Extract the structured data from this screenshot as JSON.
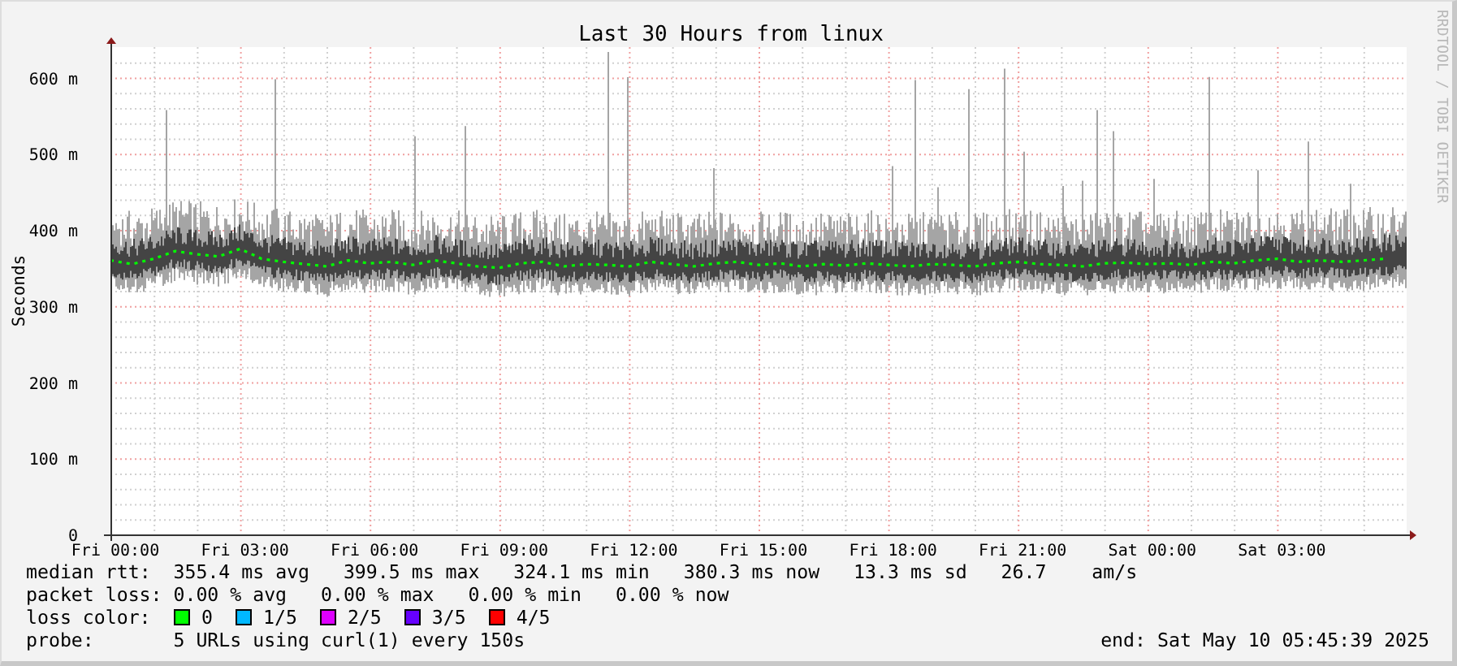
{
  "title": "Last 30 Hours from linux",
  "side_note": "RRDTOOL / TOBI OETIKER",
  "chart_data": {
    "type": "line",
    "grid": true,
    "ylabel": "Seconds",
    "ylim": [
      0,
      640
    ],
    "yticks": [
      {
        "value": 0,
        "label": "0"
      },
      {
        "value": 100,
        "label": "100 m"
      },
      {
        "value": 200,
        "label": "200 m"
      },
      {
        "value": 300,
        "label": "300 m"
      },
      {
        "value": 400,
        "label": "400 m"
      },
      {
        "value": 500,
        "label": "500 m"
      },
      {
        "value": 600,
        "label": "600 m"
      }
    ],
    "categories": [
      "Fri 00:00",
      null,
      null,
      null,
      null,
      null,
      "Fri 03:00",
      null,
      null,
      null,
      null,
      null,
      "Fri 06:00",
      null,
      null,
      null,
      null,
      null,
      "Fri 09:00",
      null,
      null,
      null,
      null,
      null,
      "Fri 12:00",
      null,
      null,
      null,
      null,
      null,
      "Fri 15:00",
      null,
      null,
      null,
      null,
      null,
      "Fri 18:00",
      null,
      null,
      null,
      null,
      null,
      "Fri 21:00",
      null,
      null,
      null,
      null,
      null,
      "Sat 00:00",
      null,
      null,
      null,
      null,
      null,
      "Sat 03:00",
      null,
      null,
      null,
      null,
      null
    ],
    "series": [
      {
        "name": "median rtt",
        "color": "#00ff00",
        "line_style": "dashed",
        "values": [
          360,
          355,
          362,
          372,
          368,
          365,
          375,
          362,
          358,
          355,
          352,
          360,
          356,
          358,
          354,
          360,
          356,
          352,
          350,
          356,
          358,
          352,
          355,
          354,
          352,
          358,
          355,
          352,
          356,
          358,
          354,
          356,
          352,
          355,
          353,
          356,
          354,
          352,
          355,
          354,
          352,
          356,
          358,
          355,
          354,
          352,
          356,
          357,
          355,
          356,
          354,
          358,
          356,
          360,
          362,
          358,
          360,
          358,
          360,
          362
        ]
      }
    ]
  },
  "legend": [
    {
      "kind": "series",
      "text": ":  355.4 ms avg   399.5 ms max   324.1 ms min   380.3 ms now   13.3 ms sd   26.7    am/s"
    },
    {
      "kind": "text",
      "text": "packet loss: 0.00 % avg   0.00 % max   0.00 % min   0.00 % now"
    },
    {
      "kind": "swatches",
      "label": "loss color:",
      "items": [
        {
          "label": "0",
          "color": "#00ff00"
        },
        {
          "label": "1/5",
          "color": "#00b8ff"
        },
        {
          "label": "2/5",
          "color": "#dd00ff"
        },
        {
          "label": "3/5",
          "color": "#6600ff"
        },
        {
          "label": "4/5",
          "color": "#ff0000"
        }
      ]
    },
    {
      "kind": "text",
      "text": "probe:       5 URLs using curl(1) every 150s"
    }
  ],
  "end": "end: Sat May 10 05:45:39 2025"
}
